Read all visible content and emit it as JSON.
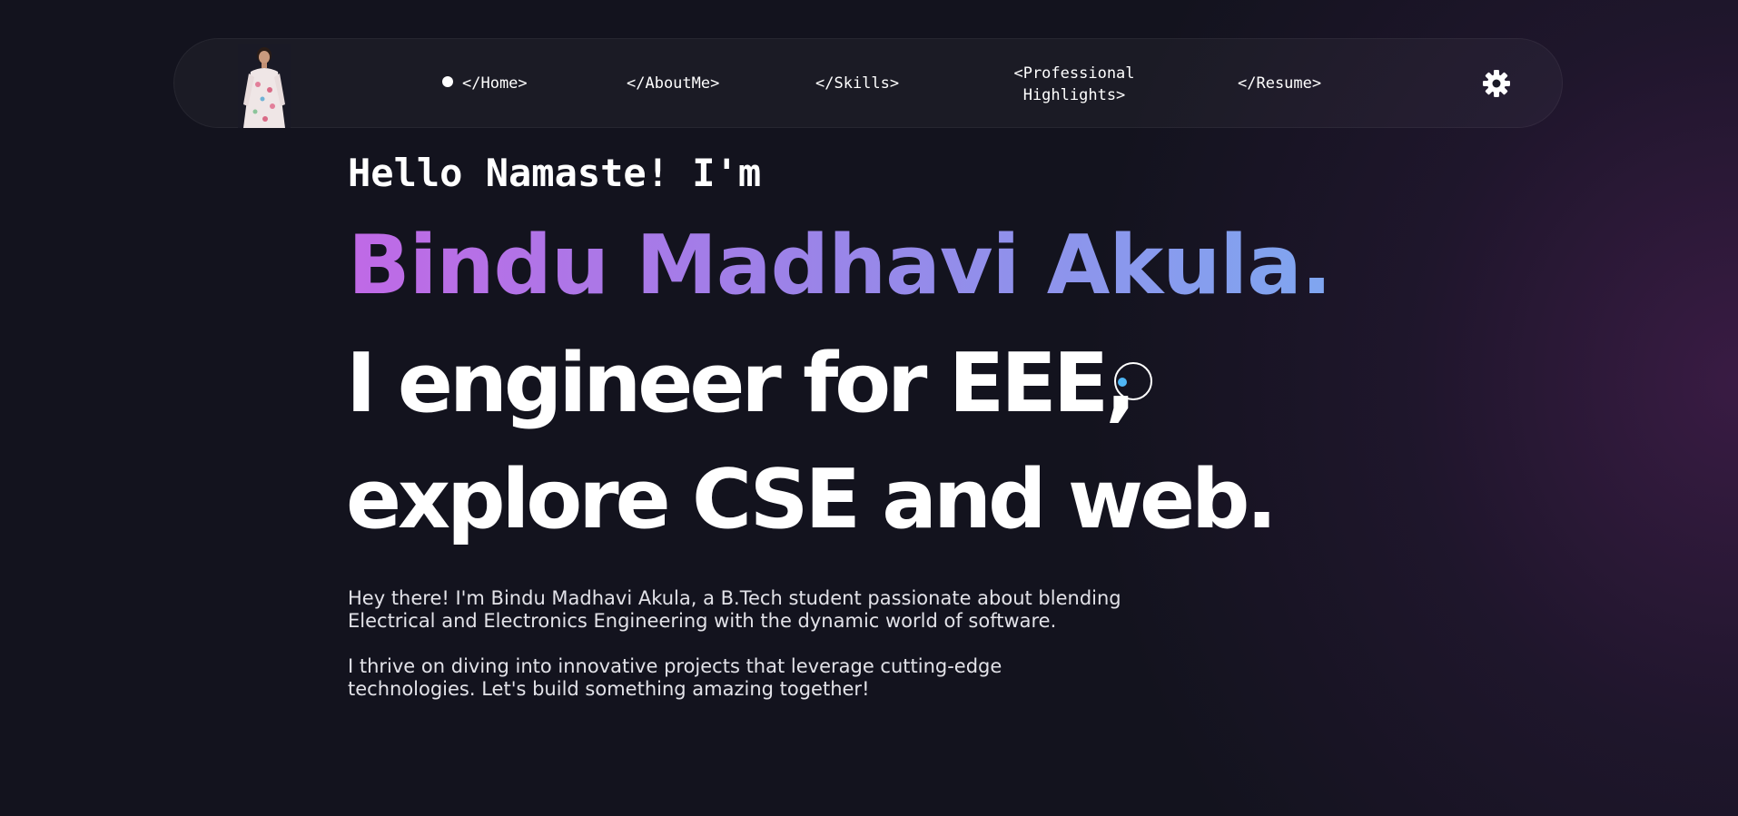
{
  "nav": {
    "items": [
      {
        "label": "</Home>",
        "active": true
      },
      {
        "label": "</AboutMe>",
        "active": false
      },
      {
        "label": "</Skills>",
        "active": false
      },
      {
        "label_line1": "<Professional",
        "label_line2": "Highlights>",
        "active": false
      },
      {
        "label": "</Resume>",
        "active": false
      }
    ],
    "settings_icon": "gear-icon",
    "avatar_icon": "profile-photo"
  },
  "hero": {
    "greeting": "Hello Namaste! I'm",
    "name": "Bindu Madhavi Akula.",
    "tagline_line1": "I engineer for EEE,",
    "tagline_line2": "explore CSE and web.",
    "paragraph1_line1": "Hey there! I'm Bindu Madhavi Akula, a B.Tech student passionate about blending",
    "paragraph1_line2": "Electrical and Electronics Engineering with the dynamic world of software.",
    "paragraph2_line1": "I thrive on diving into innovative projects that leverage cutting-edge",
    "paragraph2_line2": "technologies. Let's build something amazing together!"
  },
  "colors": {
    "background": "#13131e",
    "name_gradient_start": "#c069e6",
    "name_gradient_end": "#7fa6f0",
    "cursor_dot": "#4fb6f5"
  }
}
